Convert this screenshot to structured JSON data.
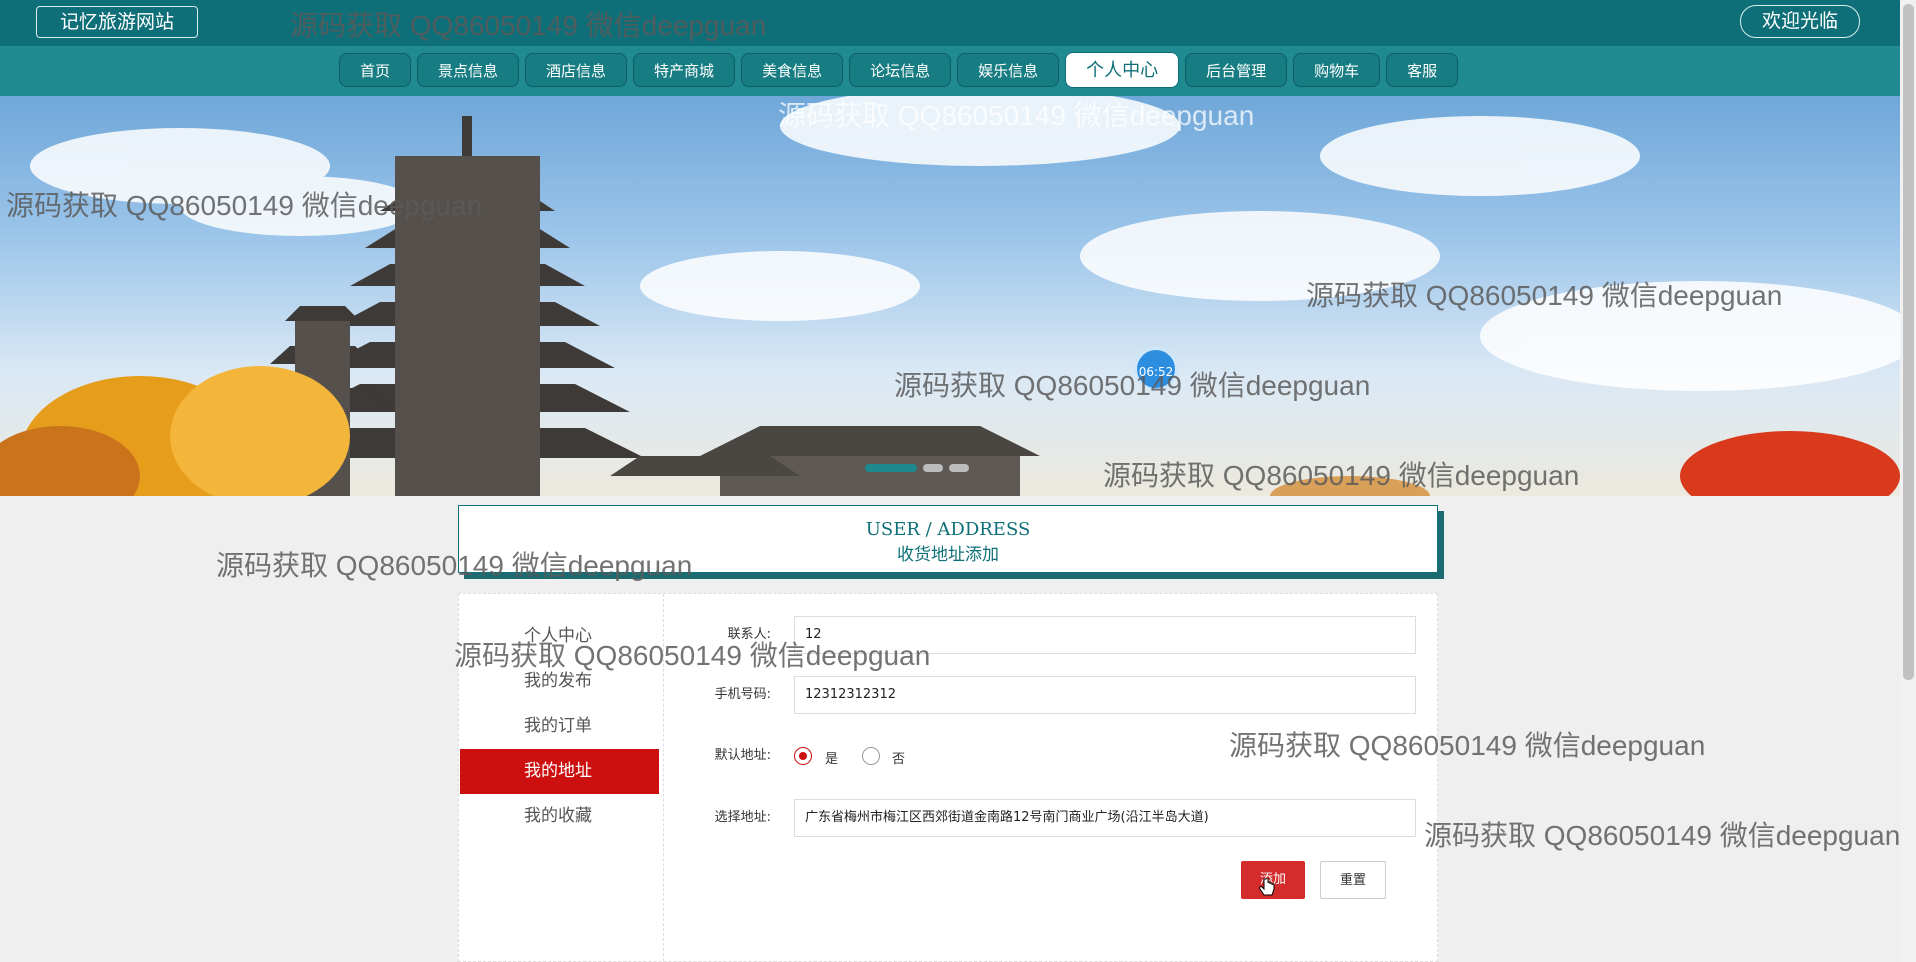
{
  "header": {
    "site_title": "记忆旅游网站",
    "welcome": "欢迎光临"
  },
  "nav": {
    "items": [
      {
        "label": "首页"
      },
      {
        "label": "景点信息"
      },
      {
        "label": "酒店信息"
      },
      {
        "label": "特产商城"
      },
      {
        "label": "美食信息"
      },
      {
        "label": "论坛信息"
      },
      {
        "label": "娱乐信息"
      },
      {
        "label": "个人中心"
      },
      {
        "label": "后台管理"
      },
      {
        "label": "购物车"
      },
      {
        "label": "客服"
      }
    ],
    "active_index": 7
  },
  "banner": {
    "clock": "06:52",
    "slide_count": 3,
    "active_slide": 0
  },
  "page_header": {
    "en": "USER / ADDRESS",
    "cn": "收货地址添加"
  },
  "sidebar": {
    "items": [
      {
        "label": "个人中心"
      },
      {
        "label": "我的发布"
      },
      {
        "label": "我的订单"
      },
      {
        "label": "我的地址"
      },
      {
        "label": "我的收藏"
      }
    ],
    "active_index": 3
  },
  "form": {
    "contact_label": "联系人:",
    "contact_value": "12",
    "phone_label": "手机号码:",
    "phone_value": "12312312312",
    "default_label": "默认地址:",
    "default_yes": "是",
    "default_no": "否",
    "default_selected": "是",
    "address_label": "选择地址:",
    "address_value": "广东省梅州市梅江区西郊街道金南路12号南门商业广场(沿江半岛大道)",
    "add_button": "添加",
    "reset_button": "重置"
  },
  "watermark": "源码获取 QQ86050149 微信deepguan",
  "colors": {
    "primary": "#0e6f78",
    "nav": "#1f8a8f",
    "accent_red": "#cc0f0f"
  }
}
